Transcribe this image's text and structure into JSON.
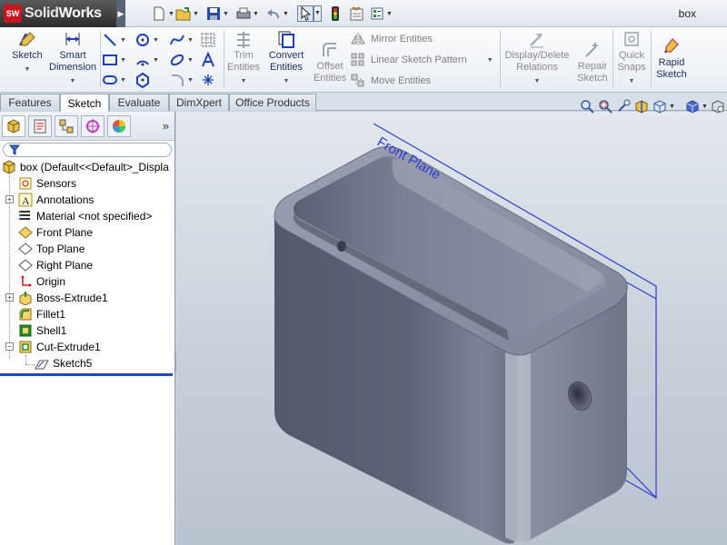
{
  "app": {
    "logo_mark": "SW",
    "name_solid": "Solid",
    "name_works": "Works"
  },
  "document": {
    "title": "box"
  },
  "quick_access": [
    "new-document-icon",
    "open-icon",
    "save-icon",
    "print-icon",
    "undo-icon",
    "select-icon",
    "rebuild-icon",
    "file-properties-icon",
    "options-icon"
  ],
  "ribbon": {
    "sketch": {
      "label": "Sketch"
    },
    "smart_dimension": {
      "label_1": "Smart",
      "label_2": "Dimension"
    },
    "trim": {
      "label_1": "Trim",
      "label_2": "Entities"
    },
    "convert": {
      "label_1": "Convert",
      "label_2": "Entities"
    },
    "offset": {
      "label_1": "Offset",
      "label_2": "Entities"
    },
    "mirror": {
      "label": "Mirror Entities"
    },
    "linear_pattern": {
      "label": "Linear Sketch Pattern"
    },
    "move": {
      "label": "Move Entities"
    },
    "display_delete": {
      "label_1": "Display/Delete",
      "label_2": "Relations"
    },
    "repair": {
      "label_1": "Repair",
      "label_2": "Sketch"
    },
    "quick_snaps": {
      "label_1": "Quick",
      "label_2": "Snaps"
    },
    "rapid_sketch": {
      "label_1": "Rapid",
      "label_2": "Sketch"
    }
  },
  "tabs": [
    {
      "label": "Features",
      "active": false
    },
    {
      "label": "Sketch",
      "active": true
    },
    {
      "label": "Evaluate",
      "active": false
    },
    {
      "label": "DimXpert",
      "active": false
    },
    {
      "label": "Office Products",
      "active": false
    }
  ],
  "tree": {
    "root": "box  (Default<<Default>_Displa",
    "items": [
      {
        "label": "Sensors",
        "icon": "sensor-icon"
      },
      {
        "label": "Annotations",
        "icon": "annotations-icon"
      },
      {
        "label": "Material <not specified>",
        "icon": "material-icon"
      },
      {
        "label": "Front Plane",
        "icon": "plane-icon"
      },
      {
        "label": "Top Plane",
        "icon": "plane-icon"
      },
      {
        "label": "Right Plane",
        "icon": "plane-icon"
      },
      {
        "label": "Origin",
        "icon": "origin-icon"
      },
      {
        "label": "Boss-Extrude1",
        "icon": "extrude-icon"
      },
      {
        "label": "Fillet1",
        "icon": "fillet-icon"
      },
      {
        "label": "Shell1",
        "icon": "shell-icon"
      },
      {
        "label": "Cut-Extrude1",
        "icon": "cut-extrude-icon"
      },
      {
        "label": "Sketch5",
        "icon": "sketch-icon"
      }
    ]
  },
  "viewport": {
    "plane_label": "Front Plane"
  },
  "colors": {
    "accent": "#1e48c8",
    "model": "#6e7486",
    "plane": "#2a3cd6"
  }
}
